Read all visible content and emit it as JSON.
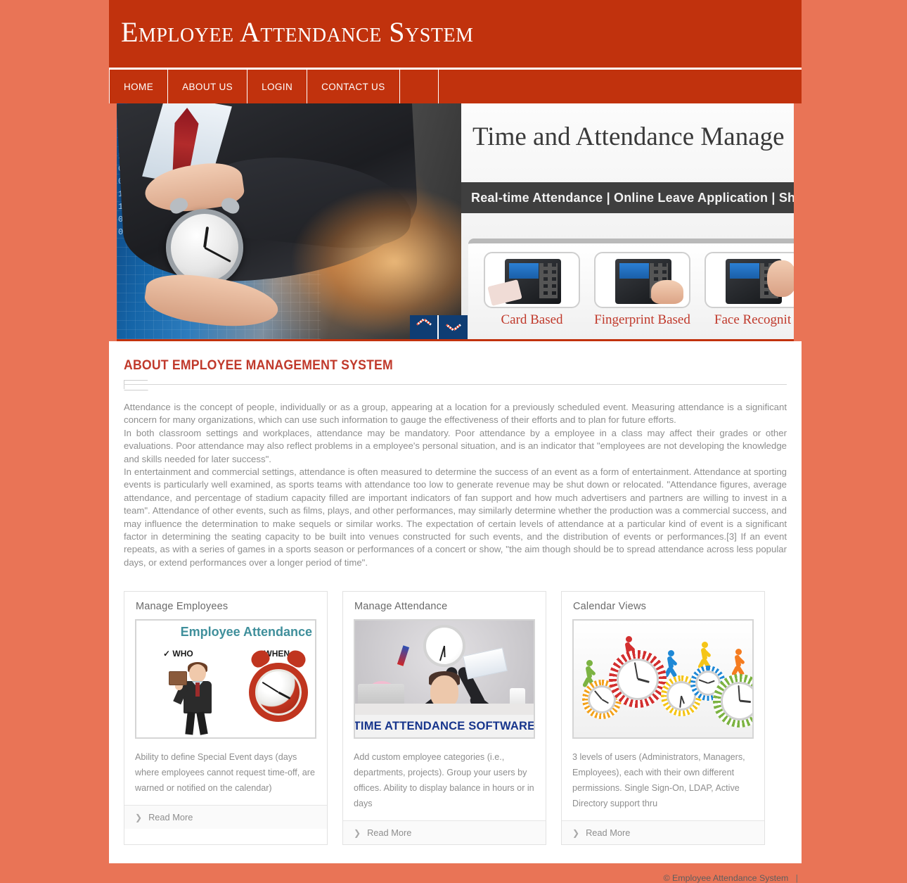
{
  "site": {
    "title": "Employee Attendance System",
    "brand_color": "#c1320d",
    "page_background": "#e97456"
  },
  "nav": {
    "items": [
      {
        "label": "HOME"
      },
      {
        "label": "ABOUT US"
      },
      {
        "label": "LOGIN"
      },
      {
        "label": "CONTACT US"
      }
    ]
  },
  "banner": {
    "headline": "Time and Attendance Manage",
    "feature_strip": "Real-time Attendance | Online Leave Application | Shift Sche",
    "devices": [
      {
        "label": "Card Based"
      },
      {
        "label": "Fingerprint Based"
      },
      {
        "label": "Face Recognit"
      }
    ],
    "controls": {
      "prev": "chevron-up-icon",
      "next": "chevron-down-icon"
    }
  },
  "about": {
    "heading": "ABOUT EMPLOYEE MANAGEMENT SYSTEM",
    "paragraphs": [
      "Attendance is the concept of people, individually or as a group, appearing at a location for a previously scheduled event. Measuring attendance is a significant concern for many organizations, which can use such information to gauge the effectiveness of their efforts and to plan for future efforts.",
      "In both classroom settings and workplaces, attendance may be mandatory. Poor attendance by a employee in a class may affect their grades or other evaluations. Poor attendance may also reflect problems in a employee's personal situation, and is an indicator that \"employees are not developing the knowledge and skills needed for later success\".",
      "In entertainment and commercial settings, attendance is often measured to determine the success of an event as a form of entertainment. Attendance at sporting events is particularly well examined, as sports teams with attendance too low to generate revenue may be shut down or relocated. \"Attendance figures, average attendance, and percentage of stadium capacity filled are important indicators of fan support and how much advertisers and partners are willing to invest in a team\". Attendance of other events, such as films, plays, and other performances, may similarly determine whether the production was a commercial success, and may influence the determination to make sequels or similar works. The expectation of certain levels of attendance at a particular kind of event is a significant factor in determining the seating capacity to be built into venues constructed for such events, and the distribution of events or performances.[3] If an event repeats, as with a series of games in a sports season or performances of a concert or show, \"the aim though should be to spread attendance across less popular days, or extend performances over a longer period of time\"."
    ]
  },
  "cards": [
    {
      "title": "Manage Employees",
      "image": {
        "heading": "Employee Attendance",
        "label_who": "✓ WHO",
        "label_when": "✓ WHEN"
      },
      "description": "Ability to define Special Event days (days where employees cannot request time-off, are warned or notified on the calendar)",
      "read_more": "Read More"
    },
    {
      "title": "Manage Attendance",
      "image": {
        "caption": "TIME ATTENDANCE SOFTWARE"
      },
      "description": "Add custom employee categories (i.e., departments, projects). Group your users by offices. Ability to display balance in hours or in days",
      "read_more": "Read More"
    },
    {
      "title": "Calendar Views",
      "image": {
        "caption": ""
      },
      "description": "3 levels of users (Administrators, Managers, Employees), each with their own different permissions. Single Sign-On, LDAP, Active Directory support thru",
      "read_more": "Read More"
    }
  ],
  "footer": {
    "copyright": "© Employee Attendance System",
    "separator": "|"
  }
}
